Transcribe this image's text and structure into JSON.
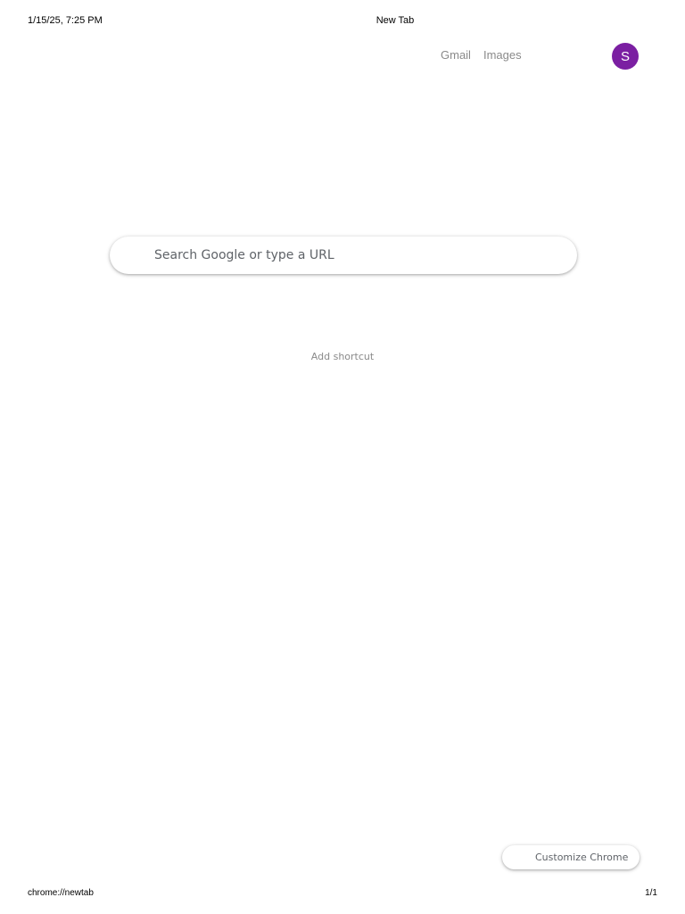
{
  "print_header": {
    "timestamp": "1/15/25, 7:25 PM",
    "title": "New Tab"
  },
  "print_footer": {
    "url": "chrome://newtab",
    "page": "1/1"
  },
  "top_nav": {
    "gmail_label": "Gmail",
    "images_label": "Images",
    "avatar_letter": "S",
    "avatar_color": "#7b1fa2"
  },
  "search": {
    "placeholder": "Search Google or type a URL",
    "value": ""
  },
  "shortcuts": {
    "add_label": "Add shortcut"
  },
  "customize": {
    "label": "Customize Chrome"
  }
}
